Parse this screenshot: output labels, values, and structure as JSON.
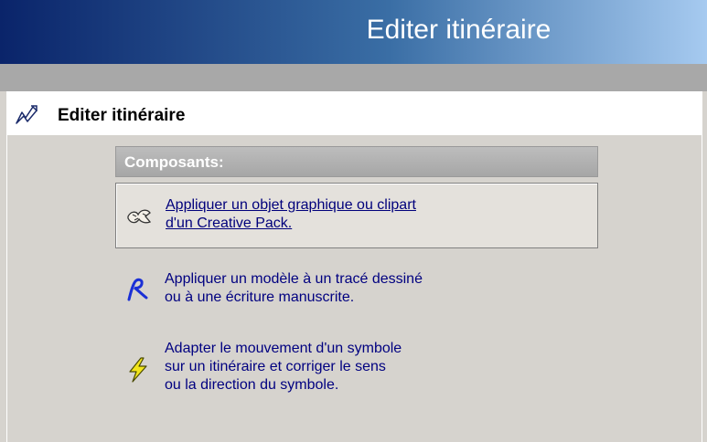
{
  "window": {
    "title": "Editer itinéraire"
  },
  "panel": {
    "title": "Editer itinéraire",
    "icon": "pen-path-icon"
  },
  "section": {
    "label": "Composants:",
    "items": [
      {
        "icon": "clipart-icon",
        "lines": [
          "Appliquer un objet graphique ou clipart",
          "d'un Creative Pack."
        ],
        "link": true,
        "selected": true
      },
      {
        "icon": "handwriting-icon",
        "lines": [
          "Appliquer un modèle à un tracé dessiné",
          "ou à une écriture manuscrite."
        ],
        "link": false,
        "selected": false
      },
      {
        "icon": "lightning-icon",
        "lines": [
          "Adapter le mouvement d'un symbole",
          "sur un itinéraire et corriger le sens",
          "ou la direction du symbole."
        ],
        "link": false,
        "selected": false
      }
    ]
  },
  "colors": {
    "title_gradient_start": "#0a246a",
    "title_gradient_end": "#a6caf0",
    "background": "#d6d3ce",
    "link_text": "#00007b"
  }
}
